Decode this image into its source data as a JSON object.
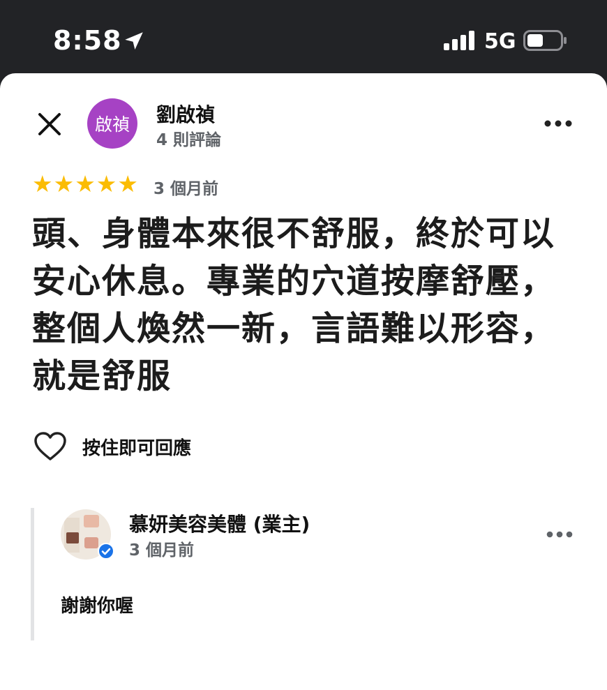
{
  "status_bar": {
    "time": "8:58",
    "network": "5G",
    "icons": [
      "location-arrow-icon",
      "signal-icon",
      "battery-icon"
    ]
  },
  "review": {
    "reviewer_name": "劉啟禎",
    "avatar_initials": "啟禎",
    "avatar_color": "#a642c4",
    "review_count": "4 則評論",
    "rating": 5,
    "rating_max": 5,
    "star_color": "#fbbc04",
    "time_ago": "3 個月前",
    "text": "頭、身體本來很不舒服，終於可以安心休息。專業的穴道按摩舒壓，整個人煥然一新，言語難以形容，就是舒服",
    "like_hint": "按住即可回應"
  },
  "owner_reply": {
    "owner_name": "慕妍美容美體 (業主)",
    "time_ago": "3 個月前",
    "text": "謝謝你喔",
    "verified_color": "#1a73e8"
  }
}
